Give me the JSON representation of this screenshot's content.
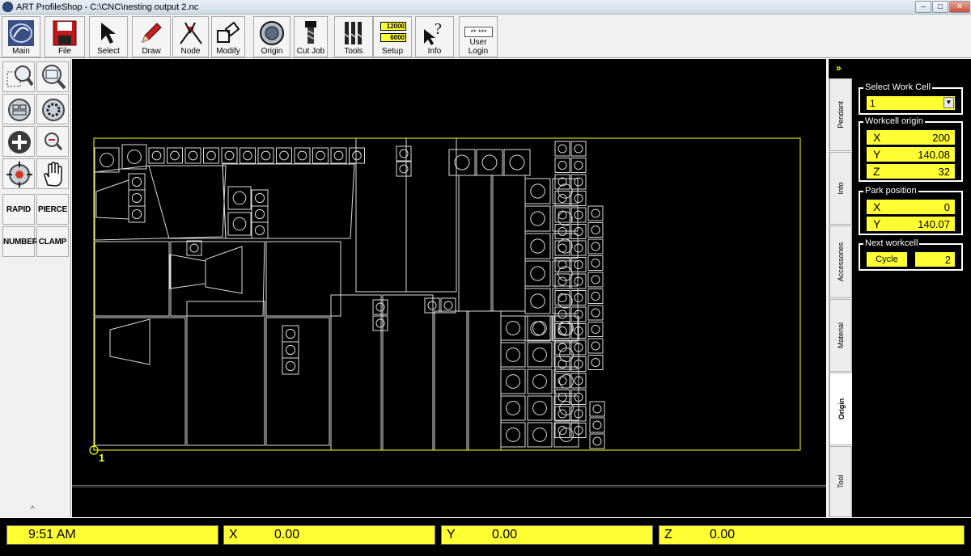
{
  "window": {
    "title": "ART ProfileShop - C:\\CNC\\nesting output 2.nc",
    "controls": [
      "minimize-icon",
      "maximize-icon",
      "close-icon"
    ]
  },
  "toolbar": {
    "buttons": [
      {
        "label": "Main",
        "icon": "main-logo-icon"
      },
      {
        "label": "File",
        "icon": "floppy-disk-icon"
      },
      {
        "label": "Select",
        "icon": "arrow-cursor-icon"
      },
      {
        "label": "Draw",
        "icon": "pencil-icon"
      },
      {
        "label": "Node",
        "icon": "node-edit-icon"
      },
      {
        "label": "Modify",
        "icon": "modify-shape-icon"
      },
      {
        "label": "Origin",
        "icon": "origin-gear-icon"
      },
      {
        "label": "Cut Job",
        "icon": "cutter-bit-icon"
      },
      {
        "label": "Tools",
        "icon": "tool-bits-icon"
      },
      {
        "label": "Setup",
        "icon": "setup-values-icon",
        "values": [
          "12000",
          "6000"
        ]
      },
      {
        "label": "Info",
        "icon": "help-cursor-icon"
      },
      {
        "label": "User Login",
        "icon": "password-icon",
        "text": "** ***"
      }
    ]
  },
  "palette": {
    "icon_buttons": [
      "zoom-window-icon",
      "zoom-extents-icon",
      "zoom-all-icon",
      "zoom-gear-icon",
      "zoom-in-icon",
      "zoom-out-icon",
      "zoom-target-icon",
      "pan-hand-icon"
    ],
    "text_buttons": [
      "RAPID",
      "PIERCE",
      "NUMBER",
      "CLAMP"
    ],
    "collapse_glyph": "^"
  },
  "canvas": {
    "origin_label": "1",
    "colors": {
      "background": "#000000",
      "sheet_border": "#ffff00",
      "parts": "#ffffff"
    }
  },
  "right_panel": {
    "expand_glyph": "»",
    "tabs": [
      "Pendant",
      "Info",
      "Accessories",
      "Material",
      "Origin",
      "Tool"
    ],
    "active_tab": "Origin",
    "select_work_cell": {
      "title": "Select Work Cell",
      "value": "1"
    },
    "workcell_origin": {
      "title": "Workcell origin",
      "x_label": "X",
      "x": "200",
      "y_label": "Y",
      "y": "140.08",
      "z_label": "Z",
      "z": "32"
    },
    "park_position": {
      "title": "Park position",
      "x_label": "X",
      "x": "0",
      "y_label": "Y",
      "y": "140.07"
    },
    "next_workcell": {
      "title": "Next workcell",
      "button": "Cycle",
      "value": "2"
    }
  },
  "status": {
    "time": "9:51 AM",
    "x_label": "X",
    "x": "0.00",
    "y_label": "Y",
    "y": "0.00",
    "z_label": "Z",
    "z": "0.00"
  }
}
